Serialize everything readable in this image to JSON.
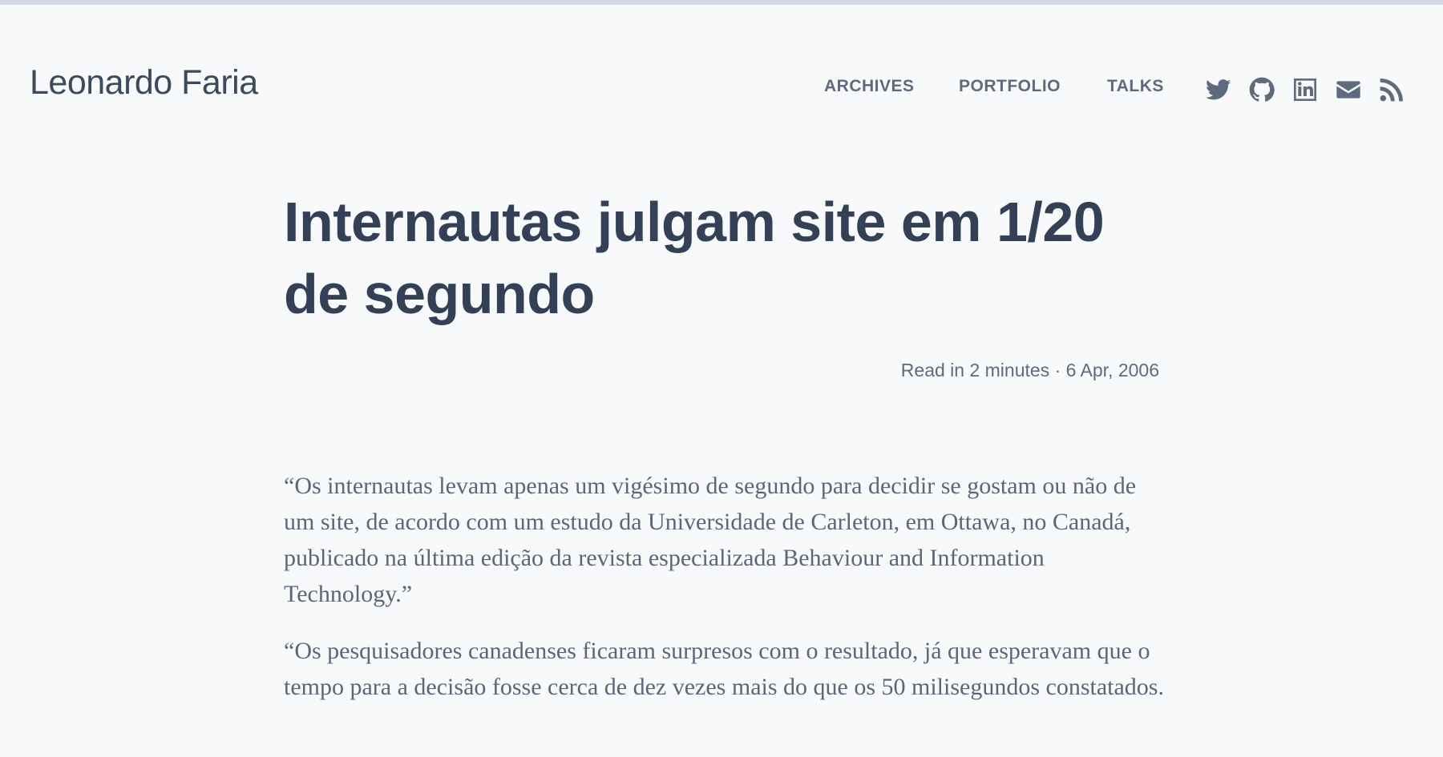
{
  "site": {
    "title": "Leonardo Faria"
  },
  "nav": {
    "items": [
      {
        "label": "ARCHIVES"
      },
      {
        "label": "PORTFOLIO"
      },
      {
        "label": "TALKS"
      }
    ]
  },
  "social": {
    "icons": [
      "twitter-icon",
      "github-icon",
      "linkedin-icon",
      "email-icon",
      "rss-icon"
    ],
    "color": "#5f6b7d"
  },
  "article": {
    "title": "Internautas julgam site em 1/20 de segundo",
    "meta": "Read in 2 minutes · 6 Apr, 2006",
    "paragraphs": [
      "“Os internautas levam apenas um vigésimo de segundo para decidir se gostam ou não de um site, de acordo com um estudo da Universidade de Carleton, em Ottawa, no Canadá, publicado na última edição da revista especializada Behaviour and Information Technology.”",
      "“Os pesquisadores canadenses ficaram surpresos com o resultado, já que esperavam que o tempo para a decisão fosse cerca de dez vezes mais do que os 50 milisegundos constatados."
    ]
  },
  "colors": {
    "background": "#f8f9fb",
    "title": "#344055",
    "text": "#5c6678",
    "nav": "#5f6b7d",
    "top_border": "#d5d8e0"
  }
}
